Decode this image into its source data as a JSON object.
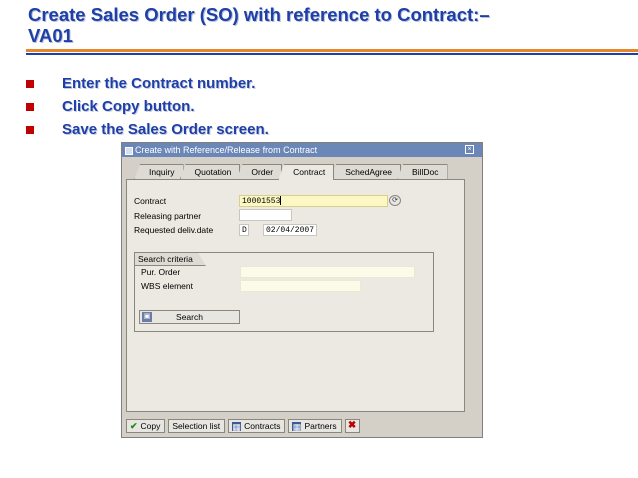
{
  "slide": {
    "title_line1": "Create Sales Order (SO) with reference to Contract:–",
    "title_line2": "VA01",
    "bullets": [
      "Enter the Contract number.",
      "Click Copy button.",
      "Save the Sales Order screen."
    ]
  },
  "dialog": {
    "title": "Create with Reference/Release from Contract",
    "tabs": [
      "Inquiry",
      "Quotation",
      "Order",
      "Contract",
      "SchedAgree",
      "BillDoc"
    ],
    "active_tab": "Contract",
    "fields": {
      "contract_label": "Contract",
      "contract_value": "10001553",
      "releasing_partner_label": "Releasing partner",
      "releasing_partner_value": "",
      "requested_date_label": "Requested deliv.date",
      "requested_date_type": "D",
      "requested_date_value": "02/04/2007"
    },
    "search_criteria": {
      "title": "Search criteria",
      "pur_order_label": "Pur. Order",
      "pur_order_value": "",
      "wbs_label": "WBS element",
      "wbs_value": "",
      "search_button": "Search"
    },
    "toolbar": {
      "copy": "Copy",
      "selection_list": "Selection list",
      "contracts": "Contracts",
      "partners": "Partners"
    }
  },
  "colors": {
    "title_blue": "#1f3fa8",
    "orange_rule": "#e8862a",
    "bullet_red": "#c00000",
    "sap_titlebar": "#6a87b8",
    "sap_grey": "#d4d0c8",
    "required_yellow": "#fdf7c3"
  }
}
